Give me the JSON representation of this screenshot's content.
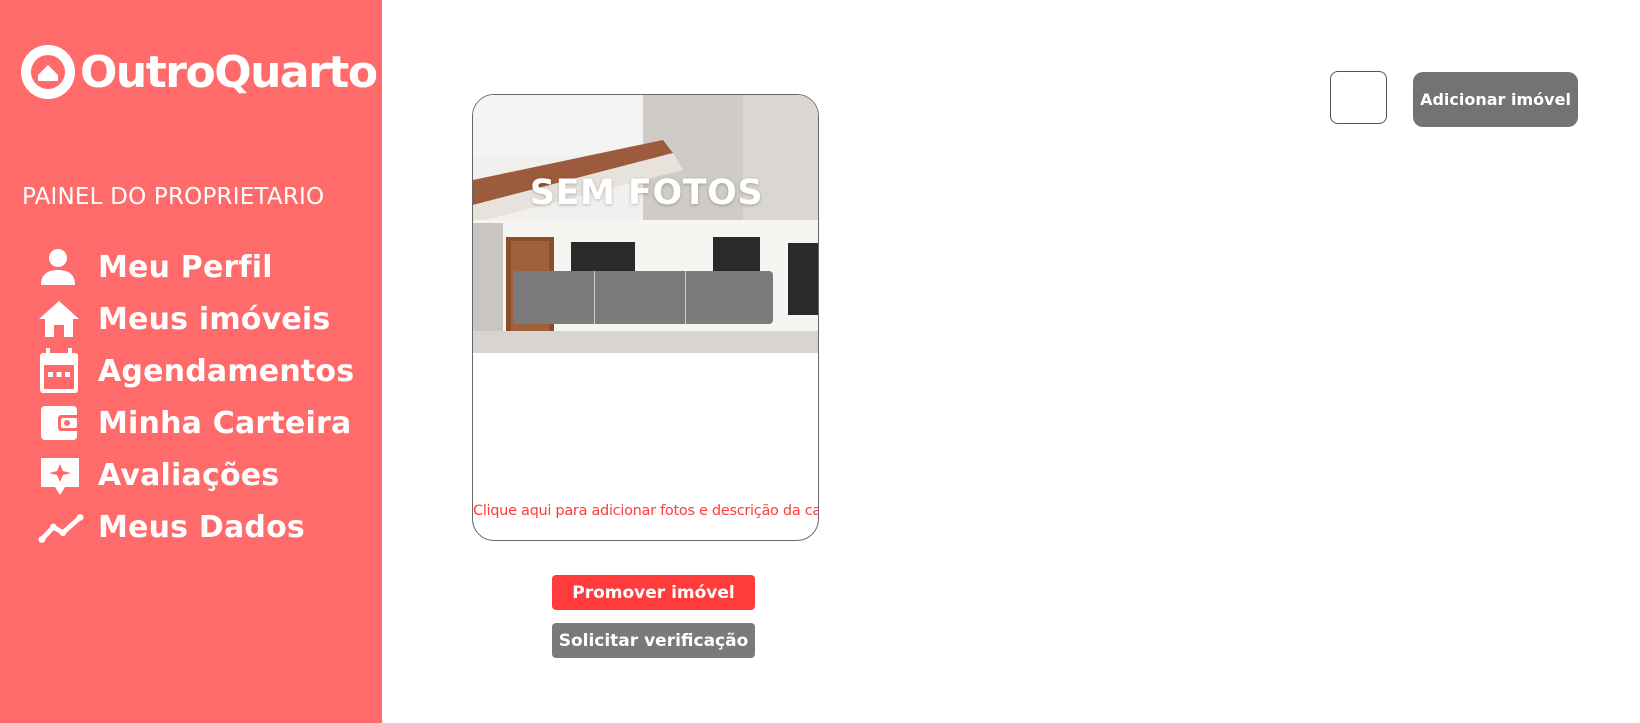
{
  "sidebar": {
    "brand": "OutroQuarto",
    "panel_title": "PAINEL DO PROPRIETARIO",
    "items": [
      {
        "label": "Meu Perfil",
        "icon": "person-icon"
      },
      {
        "label": "Meus imóveis",
        "icon": "home-icon"
      },
      {
        "label": "Agendamentos",
        "icon": "calendar-icon"
      },
      {
        "label": "Minha Carteira",
        "icon": "wallet-icon"
      },
      {
        "label": "Avaliações",
        "icon": "review-icon"
      },
      {
        "label": "Meus Dados",
        "icon": "trending-up-icon"
      }
    ],
    "color": "#ff6b6b"
  },
  "header": {
    "add_property_label": "Adicionar imóvel"
  },
  "card": {
    "overlay_text": "SEM FOTOS",
    "hint": "Clique aqui para adicionar fotos e descrição da casa"
  },
  "actions": {
    "promote_label": "Promover imóvel",
    "verify_label": "Solicitar verificação"
  },
  "colors": {
    "accent": "#ff3b3b",
    "gray_button": "#737373"
  }
}
